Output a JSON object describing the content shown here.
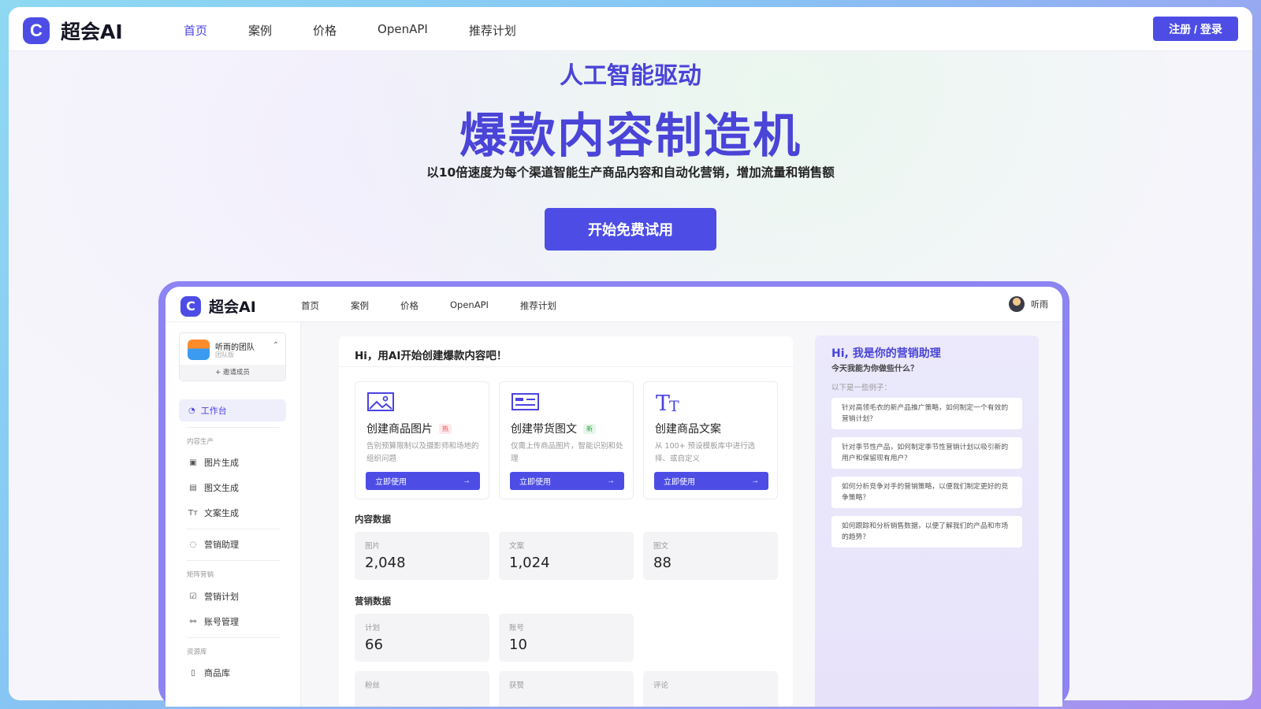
{
  "site": {
    "brand": "超会AI",
    "logo_letter": "C"
  },
  "nav": {
    "items": [
      "首页",
      "案例",
      "价格",
      "OpenAPI",
      "推荐计划"
    ],
    "active": "首页",
    "login": "注册 / 登录"
  },
  "hero": {
    "eyebrow": "人工智能驱动",
    "title": "爆款内容制造机",
    "subtitle": "以10倍速度为每个渠道智能生产商品内容和自动化营销，增加流量和销售额",
    "cta": "开始免费试用"
  },
  "preview": {
    "brand": "超会AI",
    "nav": [
      "首页",
      "案例",
      "价格",
      "OpenAPI",
      "推荐计划"
    ],
    "user": "听雨",
    "team": {
      "name": "听雨的团队",
      "plan": "团队版",
      "invite": "+ 邀请成员"
    },
    "sidebar": {
      "active": "工作台",
      "group1": "内容生产",
      "items1": [
        "图片生成",
        "图文生成",
        "文案生成"
      ],
      "assistant": "营销助理",
      "group2": "矩阵营销",
      "items2": [
        "营销计划",
        "账号管理"
      ],
      "group3": "资源库",
      "items3": [
        "商品库"
      ]
    },
    "greeting": "Hi，用AI开始创建爆款内容吧！",
    "cards": [
      {
        "title": "创建商品图片",
        "badge": "热",
        "desc": "告别预算限制以及摄影师和场地的组织问题",
        "btn": "立即使用",
        "icon": "image-icon"
      },
      {
        "title": "创建带货图文",
        "badge": "新",
        "desc": "仅需上传商品图片，智能识别和处理",
        "btn": "立即使用",
        "icon": "layout-icon"
      },
      {
        "title": "创建商品文案",
        "badge": "",
        "desc": "从 100+ 预设模板库中进行选择、或自定义",
        "btn": "立即使用",
        "icon": "text-icon"
      }
    ],
    "content_section": "内容数据",
    "content_stats": [
      {
        "label": "图片",
        "value": "2,048"
      },
      {
        "label": "文案",
        "value": "1,024"
      },
      {
        "label": "图文",
        "value": "88"
      }
    ],
    "marketing_section": "营销数据",
    "marketing_stats": [
      {
        "label": "计划",
        "value": "66"
      },
      {
        "label": "账号",
        "value": "10"
      }
    ],
    "cut_stats": [
      {
        "label": "粉丝"
      },
      {
        "label": "获赞"
      },
      {
        "label": "评论"
      }
    ],
    "assistant": {
      "title": "Hi, 我是你的营销助理",
      "subtitle": "今天我能为你做些什么？",
      "examples_label": "以下是一些例子：",
      "examples": [
        "针对高领毛衣的新产品推广策略，如何制定一个有效的营销计划？",
        "针对季节性产品，如何制定季节性营销计划以吸引新的用户和保留现有用户？",
        "如何分析竞争对手的营销策略，以便我们制定更好的竞争策略？",
        "如何跟踪和分析销售数据，以便了解我们的产品和市场的趋势？"
      ]
    }
  },
  "colors": {
    "brand": "#4d4de6",
    "frame": "#8c84f3"
  }
}
